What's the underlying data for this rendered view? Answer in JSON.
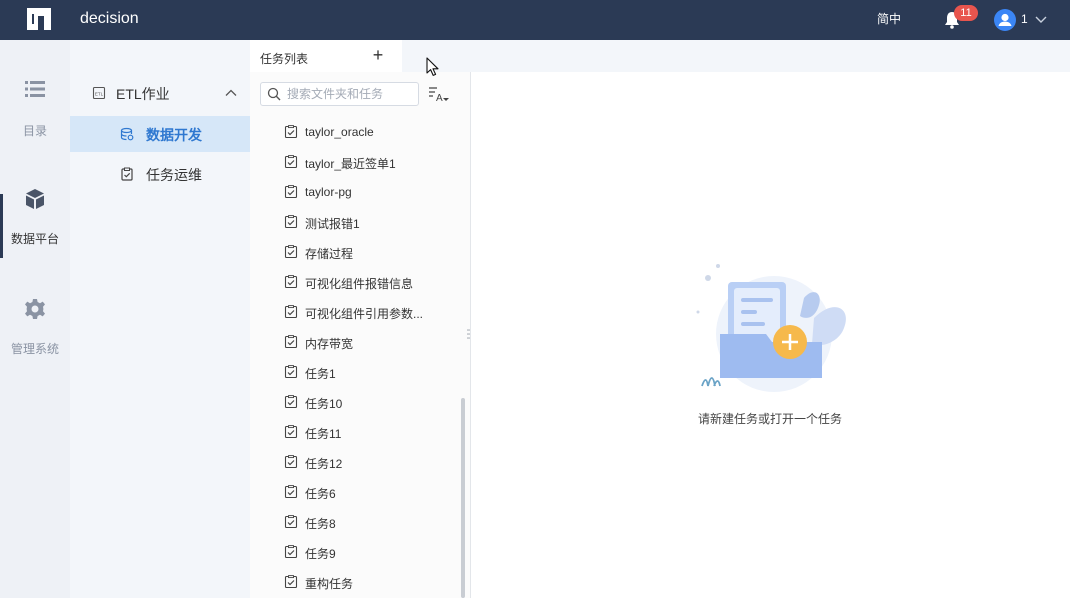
{
  "topbar": {
    "app_title": "decision",
    "language": "简中",
    "notifications": "11",
    "user_name": "1",
    "icons": [
      "logo-icon",
      "bell-icon",
      "user-icon",
      "chevron-down-icon"
    ]
  },
  "rail": {
    "items": [
      {
        "label": "目录",
        "icon": "list-icon"
      },
      {
        "label": "数据平台",
        "icon": "cube-icon",
        "active": true
      },
      {
        "label": "管理系统",
        "icon": "gear-icon"
      }
    ]
  },
  "subnav": {
    "group_label": "ETL作业",
    "items": [
      {
        "label": "数据开发",
        "icon": "database-icon",
        "active": true
      },
      {
        "label": "任务运维",
        "icon": "clipboard-icon"
      }
    ]
  },
  "task_panel": {
    "tab_label": "任务列表",
    "add_label": "+",
    "search_placeholder": "搜索文件夹和任务",
    "tasks": [
      "taylor_oracle",
      "taylor_最近签单1",
      "taylor-pg",
      "测试报错1",
      "存储过程",
      "可视化组件报错信息",
      "可视化组件引用参数...",
      "内存带宽",
      "任务1",
      "任务10",
      "任务11",
      "任务12",
      "任务6",
      "任务8",
      "任务9",
      "重构任务"
    ]
  },
  "main": {
    "empty_message": "请新建任务或打开一个任务"
  },
  "colors": {
    "topbar": "#2b3a55",
    "accent": "#2f78d0",
    "active_bg": "#d6e7f8",
    "badge": "#e8554e",
    "illustration_plus": "#f6b94c"
  }
}
